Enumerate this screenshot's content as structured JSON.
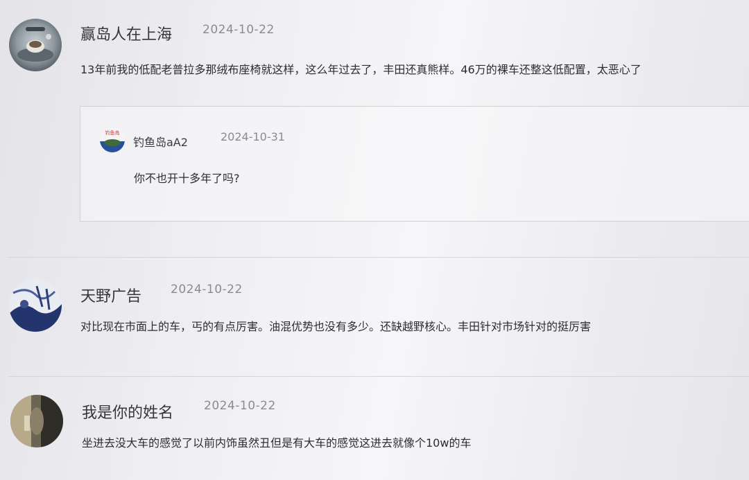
{
  "comments": [
    {
      "author": "赢岛人在上海",
      "date": "2024-10-22",
      "content": "13年前我的低配老普拉多那绒布座椅就这样，这么年过去了，丰田还真熊样。46万的裸车还整这低配置，太恶心了",
      "reply": {
        "author": "钓鱼岛aA2",
        "date": "2024-10-31",
        "content": "你不也开十多年了吗?",
        "avatar_text": "钓鱼岛"
      }
    },
    {
      "author": "天野广告",
      "date": "2024-10-22",
      "content": "对比现在市面上的车，丐的有点厉害。油混优势也没有多少。还缺越野核心。丰田针对市场针对的挺厉害"
    },
    {
      "author": "我是你的姓名",
      "date": "2024-10-22",
      "content": "坐进去没大车的感觉了以前内饰虽然丑但是有大车的感觉这进去就像个10w的车"
    }
  ],
  "colors": {
    "reply_avatar_red": "#c8373a",
    "reply_avatar_blue": "#2a4f9a"
  }
}
